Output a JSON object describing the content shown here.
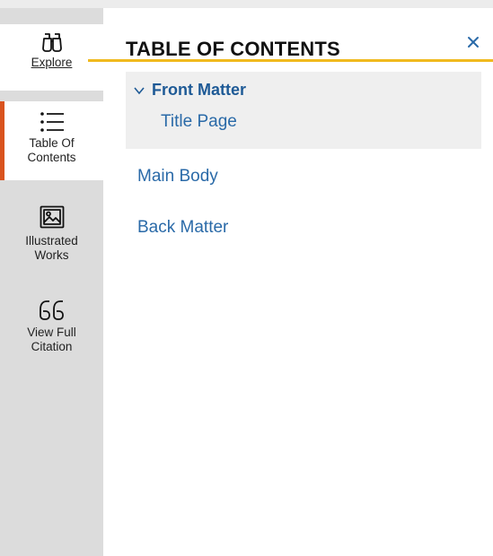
{
  "nav": {
    "explore": {
      "label": "Explore",
      "icon": "binoculars-icon"
    },
    "toc": {
      "label_line1": "Table Of",
      "label_line2": "Contents",
      "icon": "list-icon"
    },
    "works": {
      "label_line1": "Illustrated",
      "label_line2": "Works",
      "icon": "image-icon"
    },
    "citation": {
      "label_line1": "View Full",
      "label_line2": "Citation",
      "icon": "quote-icon"
    }
  },
  "panel": {
    "title": "TABLE OF CONTENTS",
    "close_icon": "close-icon",
    "sections": {
      "front_matter": {
        "label": "Front Matter",
        "expanded": true,
        "children": [
          "Title Page"
        ]
      },
      "main_body": "Main Body",
      "back_matter": "Back Matter"
    }
  },
  "colors": {
    "rail_bg": "#dcdcdc",
    "active_accent": "#d9531e",
    "title_underline": "#f0b91e",
    "link": "#2a6aa8",
    "front_matter_bg": "#efefef",
    "close": "#2a6aa8"
  }
}
